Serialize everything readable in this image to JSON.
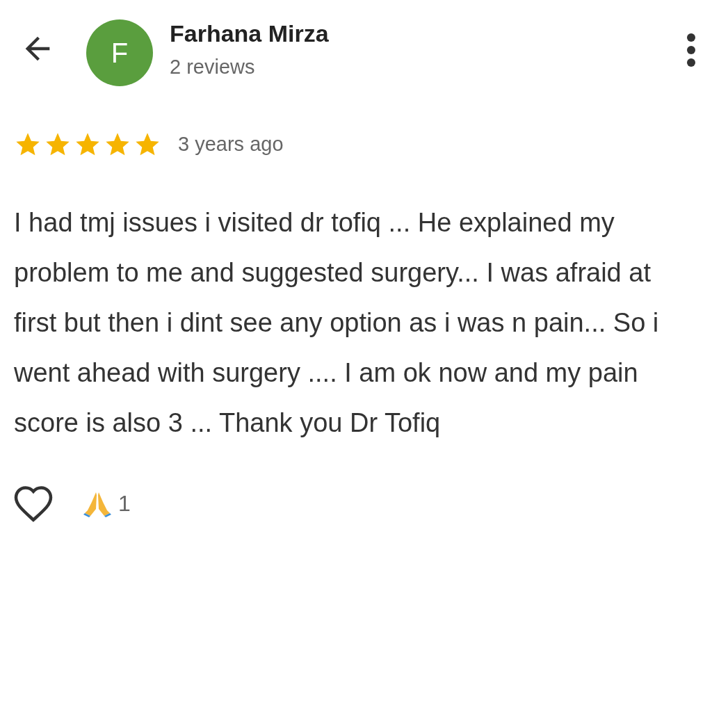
{
  "reviewer": {
    "initial": "F",
    "name": "Farhana Mirza",
    "review_count": "2 reviews"
  },
  "review": {
    "stars": 5,
    "time": "3 years ago",
    "text": "I had tmj issues i visited dr tofiq ... He explained my problem to me and suggested surgery... I was afraid at first but then i dint see any option as i was n pain... So i went ahead with surgery .... I am ok now and my pain score is also 3 ... Thank you Dr Tofiq"
  },
  "reactions": {
    "liked": false,
    "count": "1"
  }
}
